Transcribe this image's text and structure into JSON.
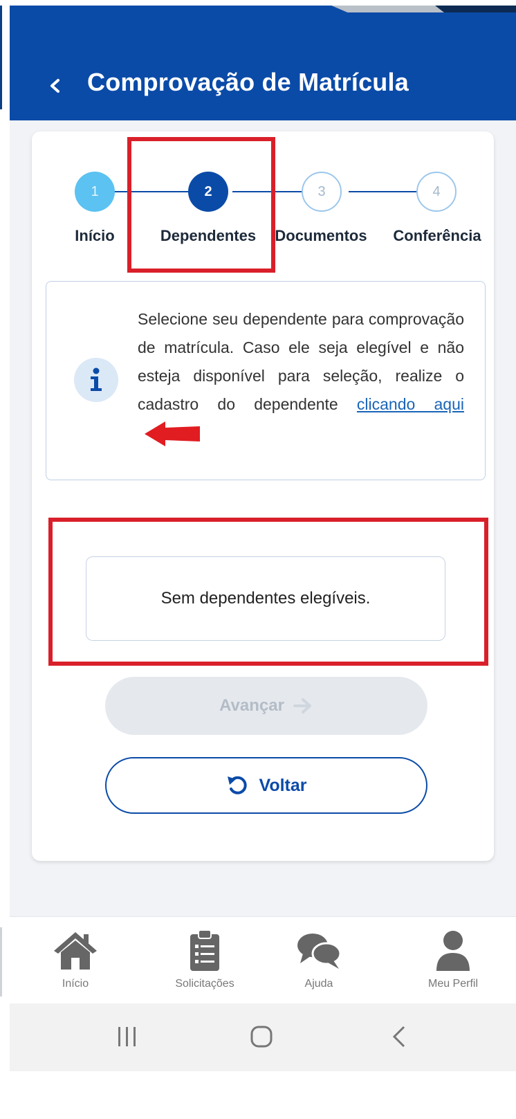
{
  "header": {
    "title": "Comprovação de Matrícula",
    "back_icon": "chevron-left-icon"
  },
  "colors": {
    "primary": "#0b4ba8",
    "step_done": "#5bc2f2",
    "highlight_red": "#d9202a",
    "link": "#1a64b8"
  },
  "stepper": {
    "current_step": 2,
    "steps": [
      {
        "number": "1",
        "label": "Início",
        "state": "done"
      },
      {
        "number": "2",
        "label": "Dependentes",
        "state": "active"
      },
      {
        "number": "3",
        "label": "Documentos",
        "state": "todo"
      },
      {
        "number": "4",
        "label": "Conferência",
        "state": "todo"
      }
    ]
  },
  "info": {
    "icon": "info-icon",
    "text": "Selecione seu dependente para comprovação de matrícula. Caso ele seja elegível e não esteja disponível para seleção, realize o cadastro do dependente",
    "link_text": "clicando aqui"
  },
  "dependents": {
    "empty_text": "Sem dependentes elegíveis."
  },
  "buttons": {
    "next_label": "Avançar",
    "next_icon": "arrow-right-icon",
    "back_label": "Voltar",
    "back_icon": "undo-icon"
  },
  "bottom_nav": {
    "items": [
      {
        "label": "Início",
        "icon": "home-icon"
      },
      {
        "label": "Solicitações",
        "icon": "clipboard-icon"
      },
      {
        "label": "Ajuda",
        "icon": "chat-icon"
      },
      {
        "label": "Meu Perfil",
        "icon": "user-icon"
      }
    ]
  },
  "system_nav": {
    "recents_icon": "recents-icon",
    "home_icon": "home-circle-icon",
    "back_icon": "back-icon"
  }
}
